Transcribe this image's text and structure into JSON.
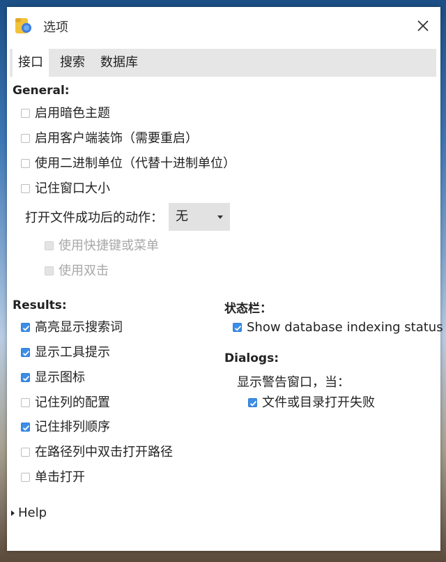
{
  "window": {
    "title": "选项",
    "accent_color": "#3b8ee8"
  },
  "tabs": [
    {
      "label": "接口",
      "active": true
    },
    {
      "label": "搜索",
      "active": false
    },
    {
      "label": "数据库",
      "active": false
    }
  ],
  "general": {
    "title": "General:",
    "options": [
      {
        "label": "启用暗色主题",
        "checked": false
      },
      {
        "label": "启用客户端装饰（需要重启）",
        "checked": false
      },
      {
        "label": "使用二进制单位（代替十进制单位）",
        "checked": false
      },
      {
        "label": "记住窗口大小",
        "checked": false
      }
    ],
    "action_label": "打开文件成功后的动作：",
    "action_value": "无",
    "sub_options": [
      {
        "label": "使用快捷键或菜单",
        "checked": false,
        "disabled": true
      },
      {
        "label": "使用双击",
        "checked": false,
        "disabled": true
      }
    ]
  },
  "results": {
    "title": "Results:",
    "options": [
      {
        "label": "高亮显示搜索词",
        "checked": true
      },
      {
        "label": "显示工具提示",
        "checked": true
      },
      {
        "label": "显示图标",
        "checked": true
      },
      {
        "label": "记住列的配置",
        "checked": false
      },
      {
        "label": "记住排列顺序",
        "checked": true
      },
      {
        "label": "在路径列中双击打开路径",
        "checked": false
      },
      {
        "label": "单击打开",
        "checked": false
      }
    ]
  },
  "statusbar": {
    "title": "状态栏：",
    "options": [
      {
        "label": "Show database indexing status",
        "checked": true
      }
    ]
  },
  "dialogs": {
    "title": "Dialogs:",
    "subtitle": "显示警告窗口，当：",
    "options": [
      {
        "label": "文件或目录打开失败",
        "checked": true
      }
    ]
  },
  "help": {
    "label": "Help"
  }
}
